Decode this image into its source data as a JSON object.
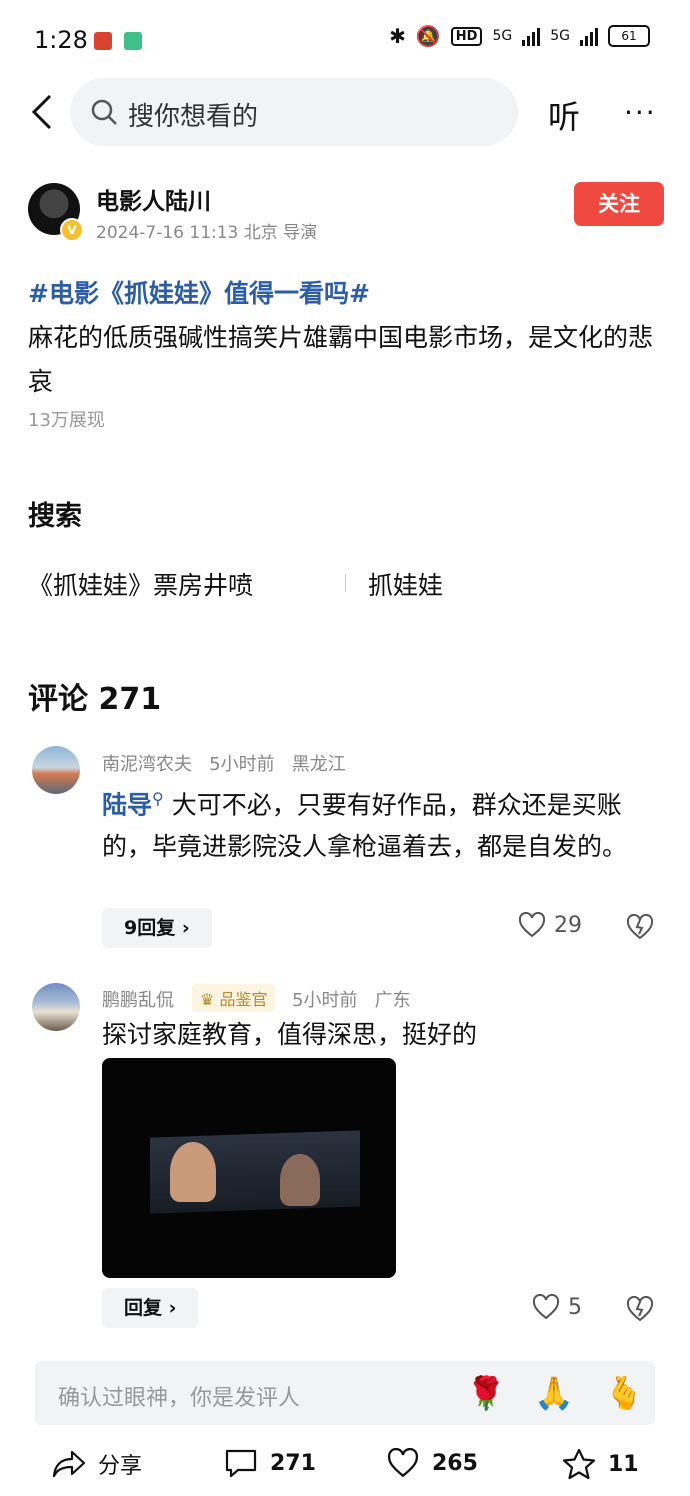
{
  "status_bar": {
    "time": "1:28",
    "network1": "5G",
    "network2": "5G",
    "hd": "HD",
    "battery": "61"
  },
  "header": {
    "search_placeholder": "搜你想看的",
    "listen_label": "听",
    "more_label": "···"
  },
  "author": {
    "name": "电影人陆川",
    "meta": "2024-7-16 11:13  北京  导演",
    "follow_label": "关注",
    "verified_mark": "V"
  },
  "post": {
    "topic": "#电影《抓娃娃》值得一看吗#",
    "body": "麻花的低质强碱性搞笑片雄霸中国电影市场，是文化的悲哀",
    "views": "13万展现"
  },
  "search_section": {
    "title": "搜索",
    "suggestions": [
      "《抓娃娃》票房井喷",
      "抓娃娃"
    ]
  },
  "comments_section": {
    "title": "评论 271"
  },
  "comments": [
    {
      "user": "南泥湾农夫",
      "time": "5小时前",
      "location": "黑龙江",
      "mention": "陆导",
      "text": "大可不必，只要有好作品，群众还是买账的，毕竟进影院没人拿枪逼着去，都是自发的。",
      "reply_label": "9回复 ›",
      "likes": "29"
    },
    {
      "user": "鹏鹏乱侃",
      "badge": "品鉴官",
      "time": "5小时前",
      "location": "广东",
      "text": "探讨家庭教育，值得深思，挺好的",
      "reply_label": "回复 ›",
      "likes": "5"
    }
  ],
  "input_bar": {
    "placeholder": "确认过眼神，你是发评人",
    "emojis": [
      "🌹",
      "🙏",
      "🫰"
    ]
  },
  "bottom_bar": {
    "share_label": "分享",
    "comments_count": "271",
    "likes_count": "265",
    "favorites_count": "11"
  }
}
